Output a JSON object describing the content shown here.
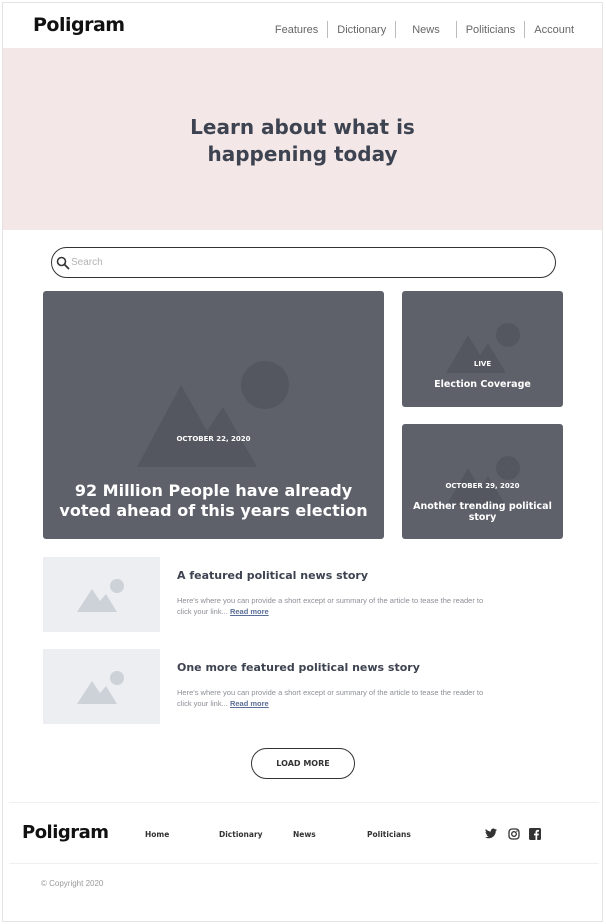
{
  "header": {
    "logo": "Poligram",
    "nav": [
      "Features",
      "Dictionary",
      "News",
      "Politicians",
      "Account"
    ]
  },
  "hero": {
    "title_line1": "Learn about what is",
    "title_line2": "happening today"
  },
  "search": {
    "placeholder": "Search"
  },
  "cards": {
    "main": {
      "date": "OCTOBER 22, 2020",
      "title": "92 Million People have already voted ahead of this years election"
    },
    "side1": {
      "tag": "LIVE",
      "title": "Election Coverage"
    },
    "side2": {
      "date": "OCTOBER 29, 2020",
      "title": "Another trending political story"
    }
  },
  "stories": [
    {
      "title": "A featured political news story",
      "excerpt": "Here's where you can provide a short except or summary of the article to tease the reader to click your link...",
      "link": "Read more"
    },
    {
      "title": "One more featured political news story",
      "excerpt": "Here's where you can provide a short except or summary of the article to tease the reader to click your link...",
      "link": "Read more"
    }
  ],
  "load_more": "LOAD MORE",
  "footer": {
    "logo": "Poligram",
    "links": [
      "Home",
      "Dictionary",
      "News",
      "Politicians"
    ],
    "social_icons": [
      "twitter-icon",
      "instagram-icon",
      "facebook-icon"
    ],
    "copyright": "© Copyright 2020"
  },
  "colors": {
    "hero_bg": "#f3e7e7",
    "card_bg": "#5e616a",
    "thumb_bg": "#eceef1",
    "text_dark": "#3d4350"
  }
}
